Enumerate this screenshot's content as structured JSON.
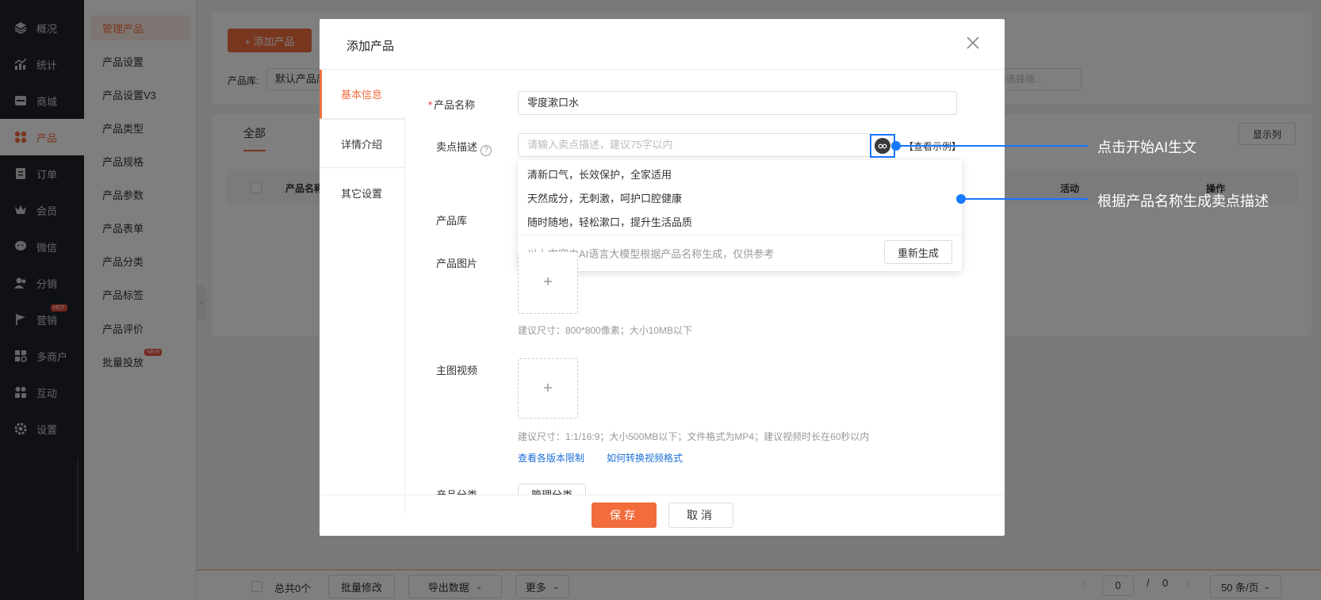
{
  "nav": {
    "items": [
      {
        "label": "概况",
        "icon": "layers-icon"
      },
      {
        "label": "统计",
        "icon": "chart-icon"
      },
      {
        "label": "商城",
        "icon": "store-icon"
      },
      {
        "label": "产品",
        "icon": "grid-icon"
      },
      {
        "label": "订单",
        "icon": "order-icon"
      },
      {
        "label": "会员",
        "icon": "crown-icon"
      },
      {
        "label": "微信",
        "icon": "wechat-icon"
      },
      {
        "label": "分销",
        "icon": "users-icon"
      },
      {
        "label": "营销",
        "icon": "flag-icon",
        "badge": "HOT"
      },
      {
        "label": "多商户",
        "icon": "merchant-icon"
      },
      {
        "label": "互动",
        "icon": "interact-icon"
      },
      {
        "label": "设置",
        "icon": "gear-icon"
      }
    ],
    "active_index": 3
  },
  "subnav": {
    "items": [
      {
        "label": "管理产品"
      },
      {
        "label": "产品设置"
      },
      {
        "label": "产品设置V3"
      },
      {
        "label": "产品类型"
      },
      {
        "label": "产品规格"
      },
      {
        "label": "产品参数"
      },
      {
        "label": "产品表单"
      },
      {
        "label": "产品分类"
      },
      {
        "label": "产品标签"
      },
      {
        "label": "产品评价"
      },
      {
        "label": "批量投放",
        "badge": "NEW"
      }
    ]
  },
  "page": {
    "add_button": "+ 添加产品",
    "lib_label": "产品库:",
    "lib_value": "默认产品库",
    "filter_placeholder": "请选择筛...",
    "tab_all": "全部",
    "show_columns": "显示列",
    "col_name": "产品名称",
    "col_activity": "活动",
    "col_operation": "操作"
  },
  "footer": {
    "total": "总共0个",
    "batch_edit": "批量修改",
    "export": "导出数据",
    "more": "更多",
    "page_current": "0",
    "page_sep": "/",
    "page_total": "0",
    "page_size": "50 条/页"
  },
  "modal": {
    "title": "添加产品",
    "tabs": [
      "基本信息",
      "详情介绍",
      "其它设置"
    ],
    "fields": {
      "name_label": "产品名称",
      "name_value": "零度漱口水",
      "selling_label": "卖点描述",
      "selling_placeholder": "请输入卖点描述，建议75字以内",
      "see_example": "【查看示例】",
      "lib_label": "产品库",
      "image_label": "产品图片",
      "image_hint": "建议尺寸：800*800像素；大小10MB以下",
      "video_label": "主图视频",
      "video_hint": "建议尺寸：1:1/16:9；大小500MB以下；文件格式为MP4；建议视频时长在60秒以内",
      "link_versions": "查看各版本限制",
      "link_convert": "如何转换视频格式",
      "category_label": "产品分类",
      "category_button": "管理分类",
      "plus": "+"
    },
    "suggestions": [
      "清新口气，长效保护，全家适用",
      "天然成分，无刺激，呵护口腔健康",
      "随时随地，轻松漱口，提升生活品质"
    ],
    "suggest_note": "以上内容由AI语言大模型根据产品名称生成，仅供参考",
    "regenerate": "重新生成",
    "save": "保存",
    "cancel": "取消"
  },
  "callouts": {
    "start_ai": "点击开始AI生文",
    "generate_desc": "根据产品名称生成卖点描述"
  },
  "colors": {
    "accent": "#f26c3c",
    "nav_bg": "#1f2329",
    "callout_blue": "#1677ff",
    "link": "#1d6fd8"
  }
}
